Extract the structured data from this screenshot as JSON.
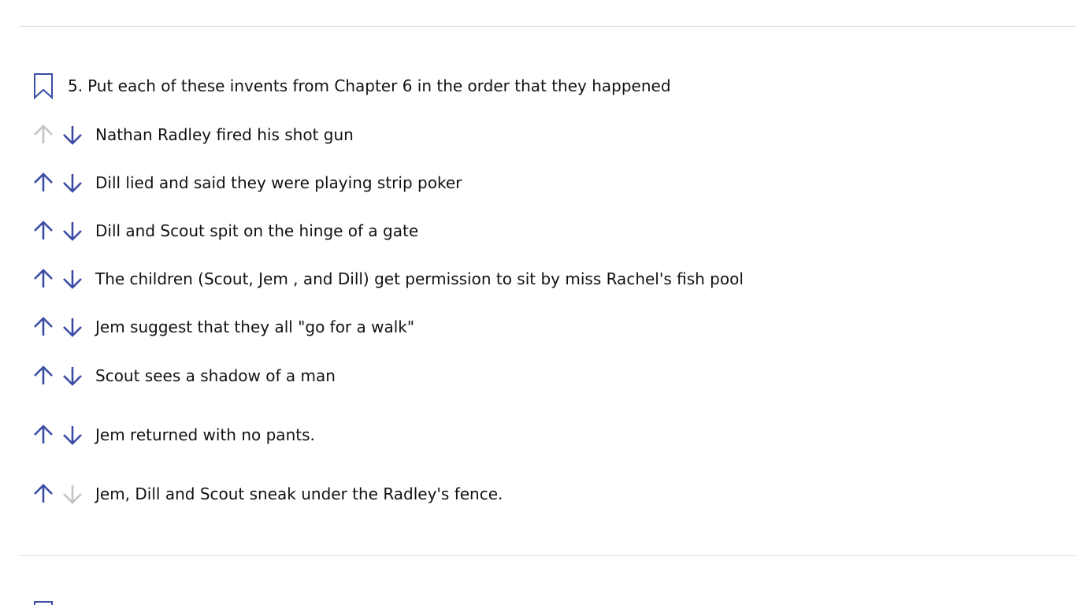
{
  "question": {
    "number": "5.",
    "text": "Put each of these invents from Chapter 6 in the order that they happened",
    "bookmark_icon": "bookmark-icon"
  },
  "colors": {
    "accent": "#3a4ca6",
    "disabled": "#c4c4c4",
    "divider": "#dcdcdc"
  },
  "items": [
    {
      "text": "Nathan Radley fired his shot gun",
      "up_enabled": false,
      "down_enabled": true
    },
    {
      "text": "Dill lied and said they were playing strip poker",
      "up_enabled": true,
      "down_enabled": true
    },
    {
      "text": "Dill and Scout spit on the hinge of a gate",
      "up_enabled": true,
      "down_enabled": true
    },
    {
      "text": "The children (Scout, Jem , and Dill) get permission to sit by miss Rachel's fish pool",
      "up_enabled": true,
      "down_enabled": true
    },
    {
      "text": "Jem suggest that they all \"go for a walk\"",
      "up_enabled": true,
      "down_enabled": true
    },
    {
      "text": "Scout sees a shadow of a man",
      "up_enabled": true,
      "down_enabled": true
    },
    {
      "text": "Jem returned with no pants.",
      "up_enabled": true,
      "down_enabled": true
    },
    {
      "text": "Jem, Dill and Scout sneak under the Radley's fence.",
      "up_enabled": true,
      "down_enabled": false
    }
  ]
}
